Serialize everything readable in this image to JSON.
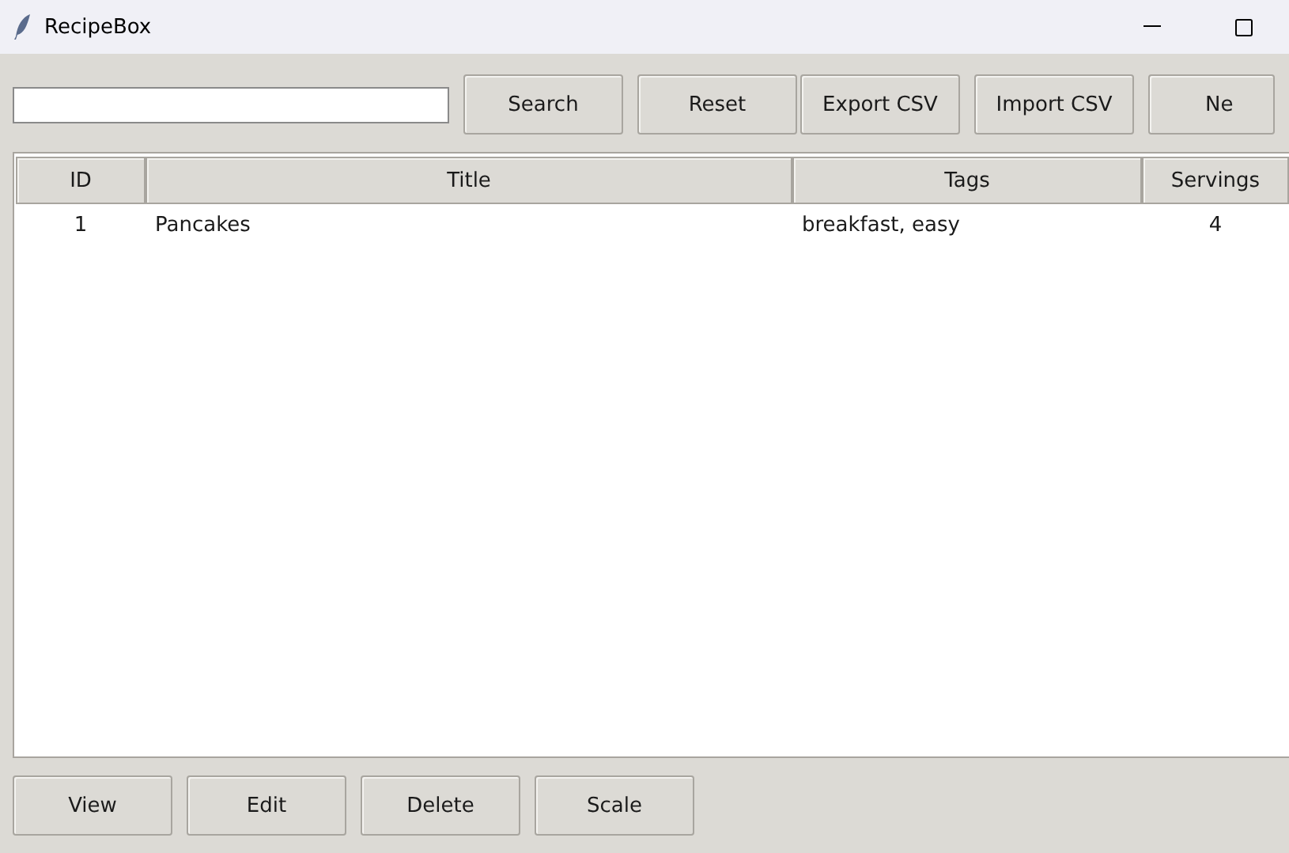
{
  "window": {
    "title": "RecipeBox"
  },
  "toolbar_buttons": [
    "Search",
    "Reset",
    "Export CSV",
    "Import CSV",
    "Ne"
  ],
  "table": {
    "columns": [
      "ID",
      "Title",
      "Tags",
      "Servings"
    ],
    "rows": [
      {
        "cells": [
          "1",
          "Pancakes",
          "breakfast, easy",
          "4"
        ],
        "selected": false
      }
    ]
  },
  "bottom_buttons": [
    "View",
    "Edit",
    "Delete",
    "Scale"
  ]
}
